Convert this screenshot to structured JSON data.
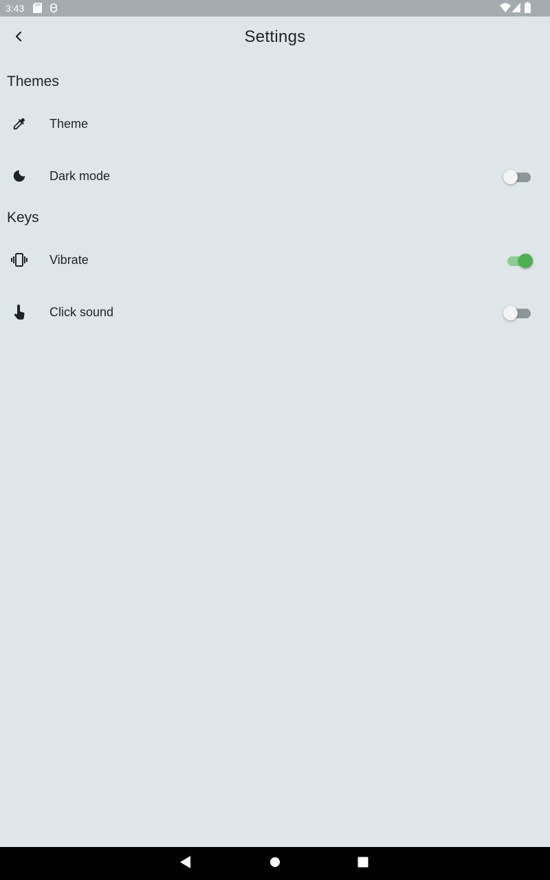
{
  "status_bar": {
    "time": "3:43",
    "left_icons": [
      "sd-card-icon",
      "usb-debug-icon"
    ],
    "right_icons": [
      "wifi-icon",
      "signal-icon",
      "battery-icon"
    ]
  },
  "app_bar": {
    "title": "Settings",
    "back_icon": "chevron-left-icon"
  },
  "sections": [
    {
      "header": "Themes",
      "items": [
        {
          "label": "Theme",
          "icon": "eyedropper-icon"
        },
        {
          "label": "Dark mode",
          "icon": "moon-icon",
          "toggle": false
        }
      ]
    },
    {
      "header": "Keys",
      "items": [
        {
          "label": "Vibrate",
          "icon": "vibrate-icon",
          "toggle": true
        },
        {
          "label": "Click sound",
          "icon": "touch-icon",
          "toggle": false
        }
      ]
    }
  ],
  "colors": {
    "background": "#dee6e9",
    "status_bar": "#a4acb0",
    "toggle_on": "#4caf50",
    "toggle_off_track": "#8e9598",
    "nav_bar": "#000000"
  },
  "nav_bar": {
    "buttons": [
      "back-triangle-icon",
      "home-circle-icon",
      "recents-square-icon"
    ]
  }
}
